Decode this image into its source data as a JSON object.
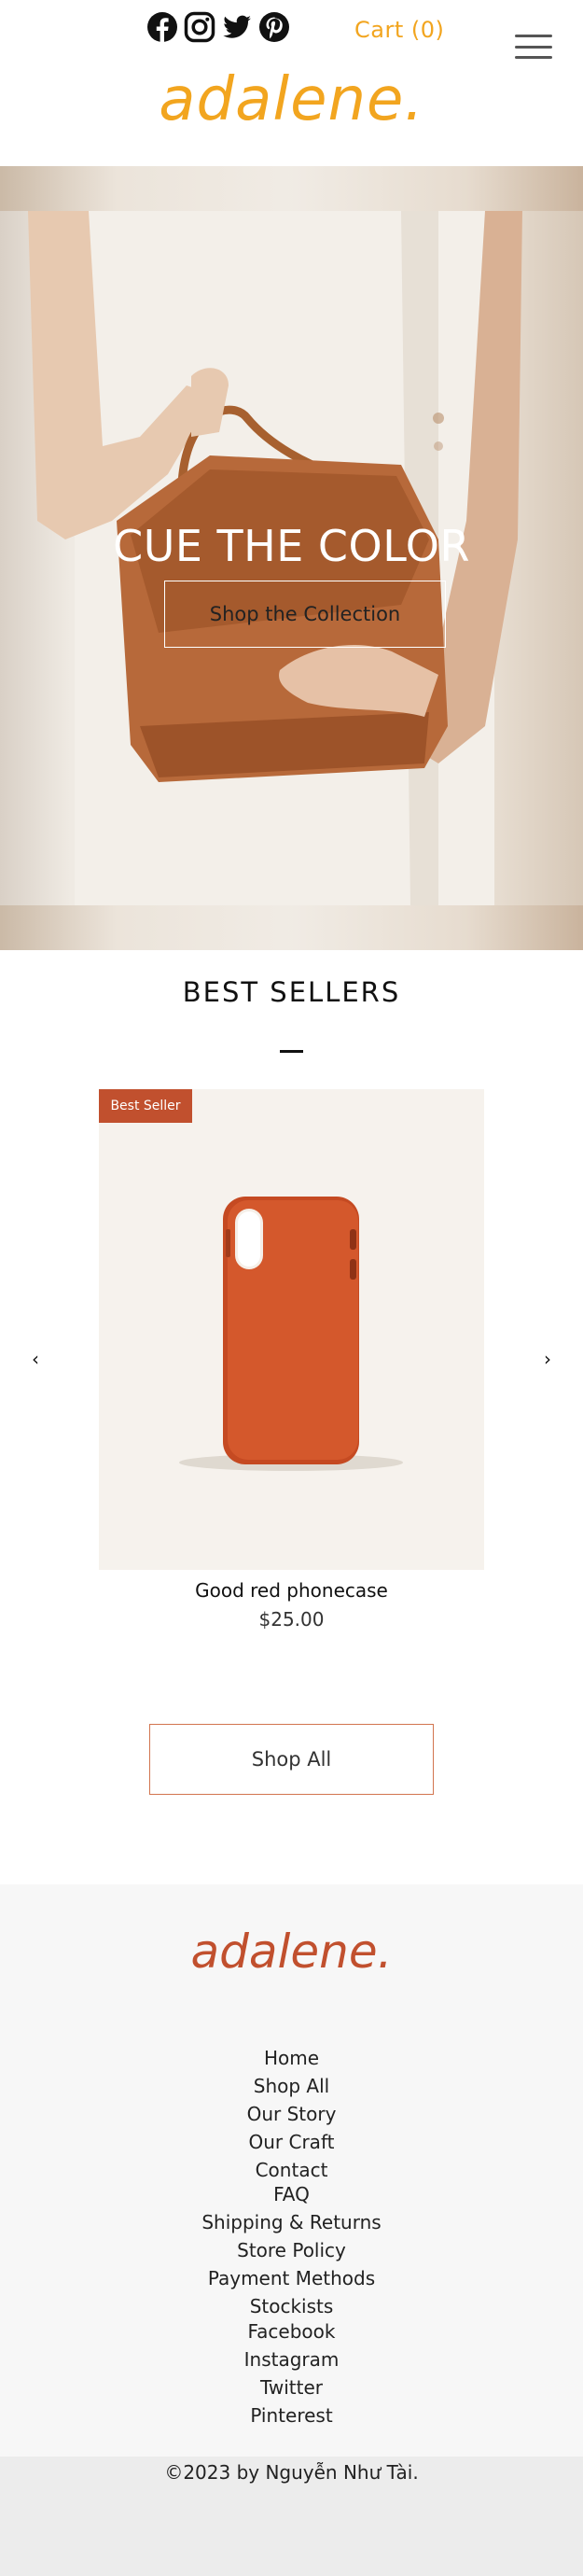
{
  "header": {
    "social": [
      {
        "name": "facebook-icon"
      },
      {
        "name": "instagram-icon"
      },
      {
        "name": "twitter-icon"
      },
      {
        "name": "pinterest-icon"
      }
    ],
    "cart_label": "Cart (0)",
    "logo": "adalene.",
    "accent_color": "#f2a51f"
  },
  "hero": {
    "title": "CUE THE COLOR",
    "button_label": "Shop the Collection"
  },
  "best_sellers": {
    "title": "BEST SELLERS",
    "prev_icon": "chevron-left-icon",
    "next_icon": "chevron-right-icon",
    "prev_glyph": "‹",
    "next_glyph": "›",
    "product": {
      "badge": "Best Seller",
      "name": "Good red phonecase",
      "price": "$25.00"
    },
    "shop_all_label": "Shop All",
    "badge_color": "#c1502e"
  },
  "footer": {
    "logo": "adalene.",
    "links": [
      "Home",
      "Shop All",
      "Our Story",
      "Our Craft",
      "Contact",
      "FAQ",
      "Shipping & Returns",
      "Store Policy",
      "Payment Methods",
      "Stockists",
      "Facebook",
      "Instagram",
      "Twitter",
      "Pinterest"
    ],
    "copyright": "©2023 by Nguyễn Như Tài."
  }
}
